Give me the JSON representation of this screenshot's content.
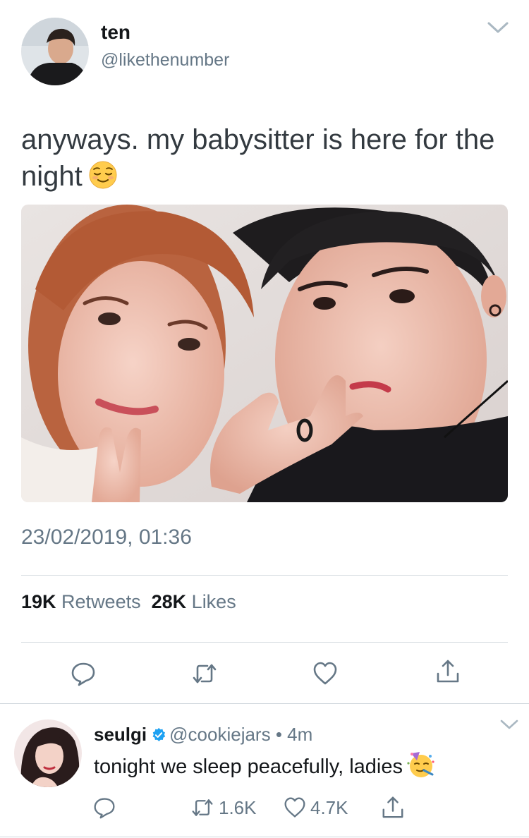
{
  "tweet": {
    "display_name": "ten",
    "handle": "@likethenumber",
    "text": "anyways. my babysitter is here for the night",
    "emoji": "relieved-face",
    "timestamp": "23/02/2019, 01:36",
    "stats": {
      "retweets_count": "19K",
      "retweets_label": "Retweets",
      "likes_count": "28K",
      "likes_label": "Likes"
    },
    "actions": [
      "reply-icon",
      "retweet-icon",
      "like-icon",
      "share-icon"
    ]
  },
  "reply": {
    "display_name": "seulgi",
    "verified": true,
    "handle": "@cookiejars",
    "separator": "•",
    "time": "4m",
    "text": "tonight we sleep peacefully, ladies",
    "emoji": "partying-face",
    "retweets": "1.6K",
    "likes": "4.7K"
  },
  "colors": {
    "text_primary": "#14171a",
    "text_secondary": "#657786",
    "divider": "#d5dbe0",
    "verified_blue": "#1da1f2"
  }
}
